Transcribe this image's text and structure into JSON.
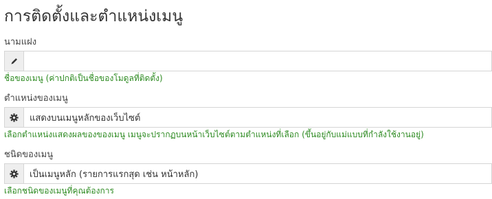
{
  "page": {
    "title": "การติดตั้งและตำแหน่งเมนู"
  },
  "fields": {
    "name": {
      "label": "นามแฝง",
      "value": "",
      "icon": "pencil-icon",
      "help": "ชื่อของเมนู (ค่าปกติเป็นชื่อของโมดูลที่ติดตั้ง)"
    },
    "position": {
      "label": "ตำแหน่งของเมนู",
      "value": "แสดงบนเมนูหลักของเว็บไซต์",
      "icon": "gear-icon",
      "help": "เลือกตำแหน่งแสดงผลของของเมนู เมนูจะปรากฏบนหน้าเว็บไซต์ตามตำแหน่งที่เลือก (ขึ้นอยู่กับแม่แบบที่กำลังใช้งานอยู่)"
    },
    "type": {
      "label": "ชนิดของเมนู",
      "value": "เป็นเมนูหลัก (รายการแรกสุด เช่น หน้าหลัก)",
      "icon": "gear-icon",
      "help": "เลือกชนิดของเมนูที่คุณต้องการ"
    }
  },
  "colors": {
    "help_text": "#2e8b22",
    "addon_bg": "#eeeeee",
    "border": "#d5d5d5"
  }
}
